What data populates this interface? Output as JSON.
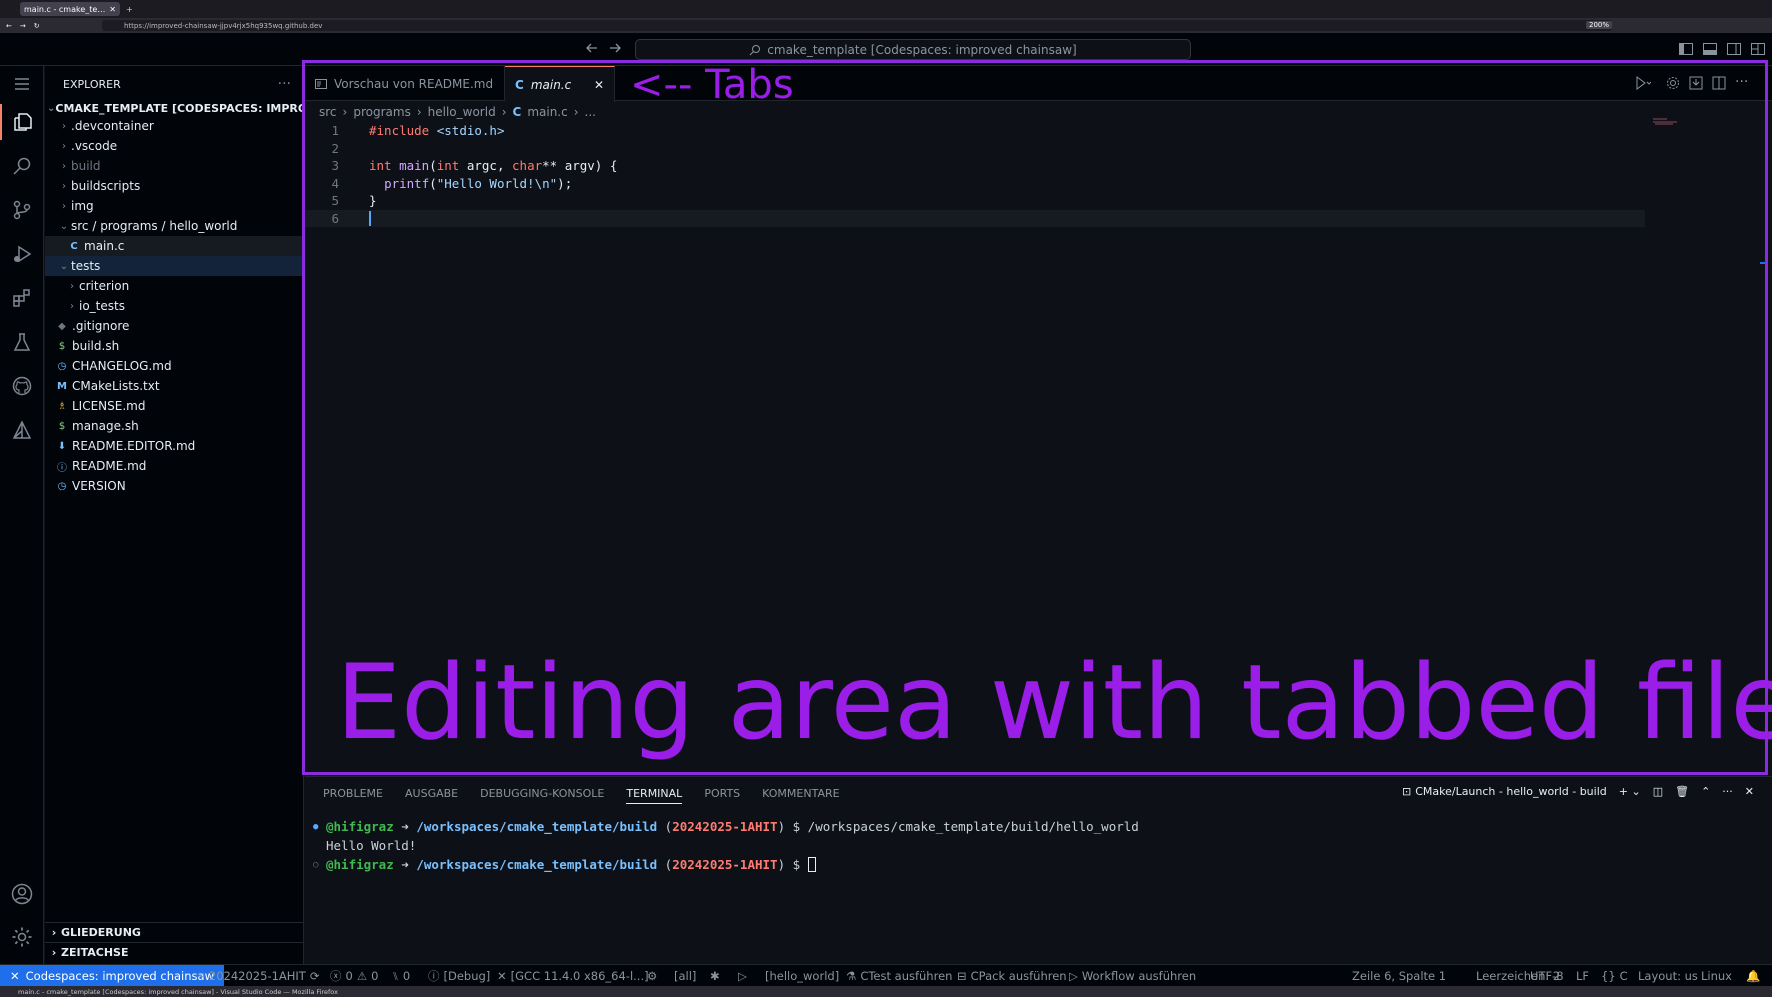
{
  "browser": {
    "tab_title": "main.c - cmake_template",
    "url": "https://improved-chainsaw-jjpv4rjx5hq935wq.github.dev",
    "zoom": "200%",
    "os_title": "main.c - cmake_template [Codespaces: improved chainsaw] - Visual Studio Code — Mozilla Firefox"
  },
  "top": {
    "search_text": "cmake_template [Codespaces: improved chainsaw]"
  },
  "sidebar": {
    "title": "EXPLORER",
    "root": "CMAKE_TEMPLATE [CODESPACES: IMPROVED C...",
    "items": [
      "devcontainer",
      ".vscode",
      "build",
      "buildscripts",
      "img",
      "src / programs / hello_world",
      "main.c",
      "tests",
      "criterion",
      "io_tests",
      ".gitignore",
      "build.sh",
      "CHANGELOG.md",
      "CMakeLists.txt",
      "LICENSE.md",
      "manage.sh",
      "README.EDITOR.md",
      "README.md",
      "VERSION"
    ],
    "outline": "GLIEDERUNG",
    "timeline": "ZEITACHSE"
  },
  "editor": {
    "tabs": [
      "Vorschau von README.md",
      "main.c"
    ],
    "breadcrumb": [
      "src",
      "programs",
      "hello_world",
      "main.c",
      "..."
    ],
    "line_numbers": [
      "1",
      "2",
      "3",
      "4",
      "5",
      "6"
    ],
    "code": {
      "l1a": "#include",
      "l1b": " <stdio.h>",
      "l3a": "int",
      "l3b": " ",
      "l3c": "main",
      "l3d": "(",
      "l3e": "int",
      "l3f": " argc, ",
      "l3g": "char",
      "l3h": "** argv) {",
      "l4a": "  ",
      "l4b": "printf",
      "l4c": "(",
      "l4d": "\"Hello World!\\n\"",
      "l4e": ");",
      "l5": "}"
    }
  },
  "annotations": {
    "tabs": "<-- Tabs",
    "editing": "Editing area with tabbed files",
    "color": "#9b1ee8"
  },
  "panel": {
    "tabs": [
      "PROBLEME",
      "AUSGABE",
      "DEBUGGING-KONSOLE",
      "TERMINAL",
      "PORTS",
      "KOMMENTARE"
    ],
    "task": "CMake/Launch - hello_world - build",
    "term": {
      "user": "@hifigraz",
      "arrow": " ➜ ",
      "path": "/workspaces/cmake_template/build",
      "branch_open": " (",
      "branch": "20242025-1AHIT",
      "branch_close": ") $ ",
      "cmd": "/workspaces/cmake_template/build/hello_world",
      "output": "Hello World!"
    }
  },
  "status": {
    "remote": "Codespaces: improved chainsaw",
    "branch": "20242025-1AHIT",
    "errors": "0",
    "warnings": "0",
    "ports": "0",
    "debug": "[Debug]",
    "kit": "[GCC 11.4.0 x86_64-l...]",
    "target_all": "[all]",
    "target": "[hello_world]",
    "ctest": "CTest ausführen",
    "cpack": "CPack ausführen",
    "workflow": "Workflow ausführen",
    "position": "Zeile 6, Spalte 1",
    "spaces": "Leerzeichen: 2",
    "encoding": "UTF-8",
    "eol": "LF",
    "lang": "C",
    "layout": "Layout: us",
    "os": "Linux"
  },
  "colors": {
    "accent": "#1f6feb",
    "annotation": "#8a2be2"
  }
}
